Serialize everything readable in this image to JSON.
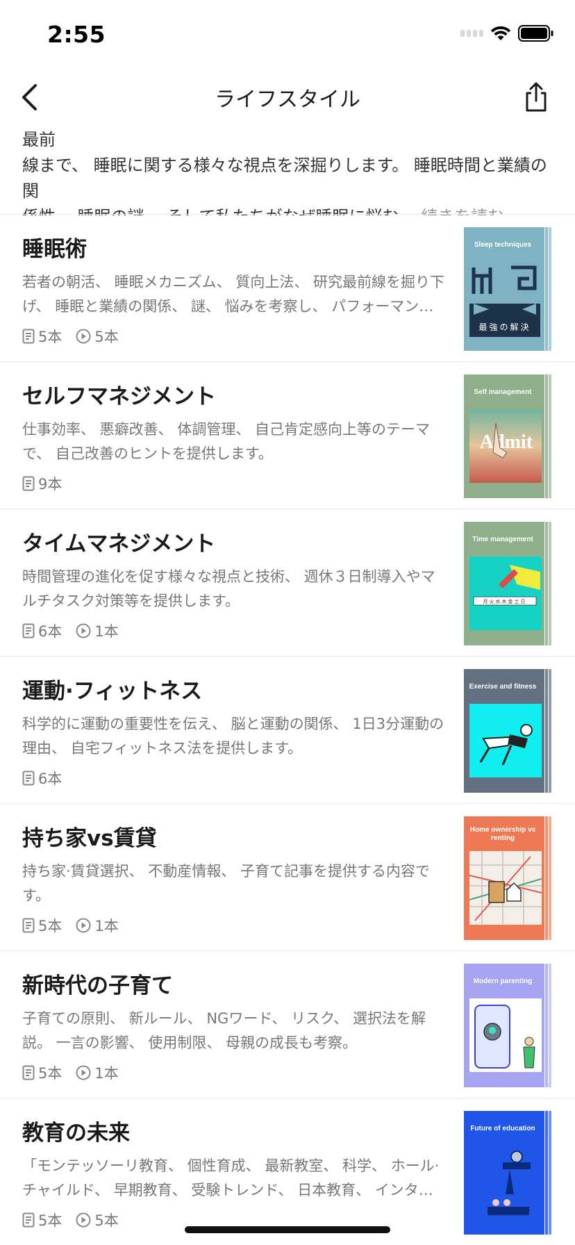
{
  "status_bar": {
    "time": "2:55"
  },
  "nav": {
    "title": "ライフスタイル"
  },
  "intro": {
    "line1": "若者の朝活問題から睡眠のメカニズム、 質を高める方法、 睡眠研究の最前",
    "line2": "線まで、 睡眠に関する様々な視点を深掘りします。 睡眠時間と業績の関",
    "line3": "係性、 睡眠の謎、 そして私たちがなぜ睡眠に悩む…",
    "read_more": "続きを読む"
  },
  "items": [
    {
      "title": "睡眠術",
      "desc": "若者の朝活、 睡眠メカニズム、 質向上法、 研究最前線を掘り下げ、 睡眠と業績の関係、 謎、 悩みを考察し、 パフォーマン…",
      "articles": "5本",
      "videos": "5本",
      "cover_label": "Sleep techniques",
      "cover_text": "最強の解決",
      "cover_color": "#7fb3c4"
    },
    {
      "title": "セルフマネジメント",
      "desc": "仕事効率、 悪癖改善、 体調管理、 自己肯定感向上等のテーマで、 自己改善のヒントを提供します。",
      "articles": "9本",
      "cover_label": "Self management",
      "cover_text": "Admit",
      "cover_color": "#8fae8c"
    },
    {
      "title": "タイムマネジメント",
      "desc": "時間管理の進化を促す様々な視点と技術、 週休３日制導入やマルチタスク対策等を提供します。",
      "articles": "6本",
      "videos": "1本",
      "cover_label": "Time management",
      "cover_text": "月火水木金土日",
      "cover_color": "#8fae8c"
    },
    {
      "title": "運動·フィットネス",
      "desc": "科学的に運動の重要性を伝え、 脳と運動の関係、 1日3分運動の理由、 自宅フィットネス法を提供します。",
      "articles": "6本",
      "cover_label": "Exercise and fitness",
      "cover_color": "#627080"
    },
    {
      "title": "持ち家vs賃貸",
      "desc": "持ち家·賃貸選択、 不動産情報、 子育て記事を提供する内容です。",
      "articles": "5本",
      "videos": "1本",
      "cover_label": "Home ownership vs renting",
      "cover_color": "#ee7a55"
    },
    {
      "title": "新時代の子育て",
      "desc": "子育ての原則、 新ルール、 NGワード、 リスク、 選択法を解説。 一言の影響、 使用制限、 母親の成長も考察。",
      "articles": "5本",
      "videos": "1本",
      "cover_label": "Modern parenting",
      "cover_color": "#a6a4f0"
    },
    {
      "title": "教育の未来",
      "desc": "「モンテッソーリ教育、 個性育成、 最新教室、 科学、 ホール·チャイルド、 早期教育、 受験トレンド、 日本教育、 インタ…",
      "articles": "5本",
      "videos": "5本",
      "cover_label": "Future of education",
      "cover_color": "#1f56e8"
    }
  ]
}
